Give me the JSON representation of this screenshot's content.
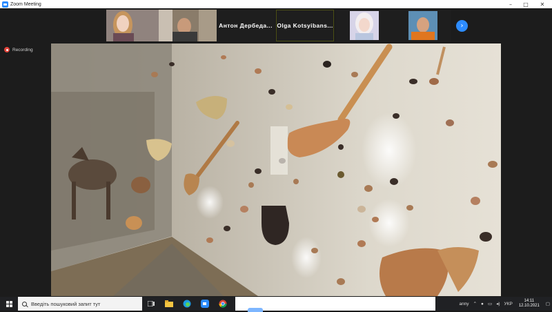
{
  "window": {
    "title": "Zoom Meeting",
    "controls": {
      "minimize": "–",
      "maximize": "□",
      "close": "✕"
    }
  },
  "participants": [
    {
      "type": "video",
      "label": ""
    },
    {
      "type": "video",
      "label": ""
    },
    {
      "type": "name",
      "label": "Антон Дербеда..."
    },
    {
      "type": "name",
      "label": "Olga Kotsyibans..."
    },
    {
      "type": "video",
      "label": ""
    },
    {
      "type": "video",
      "label": ""
    }
  ],
  "next_page_icon": "chevron-right-icon",
  "recording": {
    "label": "Recording",
    "color": "#e0433a"
  },
  "taskbar": {
    "search_placeholder": "Введіть пошуковий запит тут",
    "tray_user": "anny",
    "language": "УКР",
    "time": "14:11",
    "date": "12.10.2021"
  },
  "colors": {
    "zoom_blue": "#2d8cff",
    "recording_red": "#e0433a",
    "meeting_bg": "#1c1c1c",
    "taskbar_bg": "#202124"
  }
}
